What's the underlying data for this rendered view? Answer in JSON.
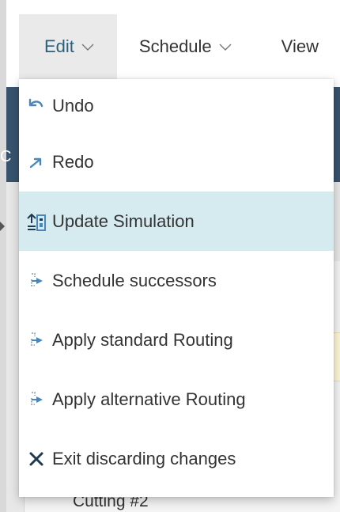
{
  "menubar": {
    "items": [
      {
        "label": "Edit"
      },
      {
        "label": "Schedule"
      },
      {
        "label": "View"
      }
    ]
  },
  "edit_menu": {
    "items": [
      {
        "label": "Undo",
        "icon": "undo-icon"
      },
      {
        "label": "Redo",
        "icon": "redo-icon"
      },
      {
        "label": "Update Simulation",
        "icon": "update-simulation-icon",
        "selected": true
      },
      {
        "label": "Schedule successors",
        "icon": "routing-icon"
      },
      {
        "label": "Apply standard Routing",
        "icon": "routing-icon"
      },
      {
        "label": "Apply alternative Routing",
        "icon": "routing-icon"
      },
      {
        "label": "Exit discarding changes",
        "icon": "close-icon"
      }
    ]
  },
  "background": {
    "partial_header_letter": "C",
    "row_text": "Cutting #2"
  },
  "colors": {
    "accent": "#2c5f7a",
    "icon_blue": "#4a87b8",
    "selected_bg": "#d5ebef",
    "header_band": "#38536f",
    "close_icon": "#1e3a52"
  }
}
